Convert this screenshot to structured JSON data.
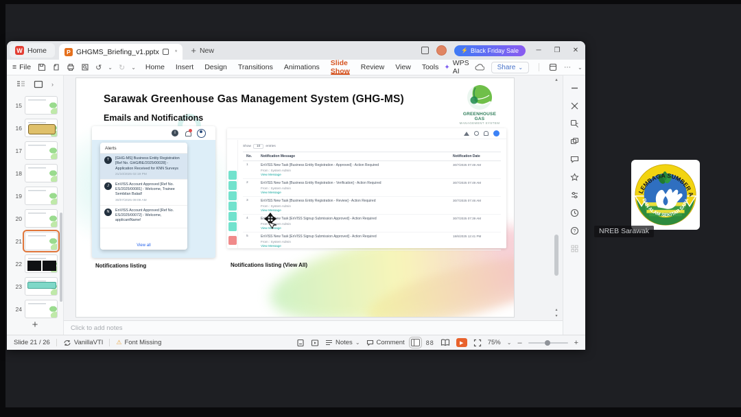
{
  "icons": {
    "hamburger": "≡",
    "caret_down": "⌄",
    "more": "⋯",
    "minimize": "─",
    "restore": "❐",
    "close": "✕",
    "plus": "+",
    "warning": "⚠",
    "unsaved_star": "*",
    "bolt": "⚡",
    "sparkle": "✦",
    "undo": "↺",
    "redo": "↻",
    "scroll_up": "▴",
    "pager": "▴\n▾",
    "info_i": "i",
    "play": "▶",
    "minus": "–",
    "chevron_right": "›",
    "grid88": "88"
  },
  "titlebar": {
    "home_tab": "Home",
    "wps_logo": "W",
    "doc_tab": "GHGMS_Briefing_v1.pptx",
    "ppt_badge": "P",
    "new_label": "New",
    "promo": "Black Friday Sale"
  },
  "menubar": {
    "file": "File",
    "items": [
      {
        "label": "Home"
      },
      {
        "label": "Insert"
      },
      {
        "label": "Design"
      },
      {
        "label": "Transitions"
      },
      {
        "label": "Animations"
      },
      {
        "label": "Slide Show",
        "active": true
      },
      {
        "label": "Review"
      },
      {
        "label": "View"
      },
      {
        "label": "Tools"
      }
    ],
    "wps_ai": "WPS AI",
    "share": "Share"
  },
  "slide_panel": {
    "slides": [
      {
        "n": "15"
      },
      {
        "n": "16",
        "variant": "gold"
      },
      {
        "n": "17"
      },
      {
        "n": "18"
      },
      {
        "n": "19"
      },
      {
        "n": "20"
      },
      {
        "n": "21",
        "selected": true
      },
      {
        "n": "22",
        "variant": "dark"
      },
      {
        "n": "23",
        "variant": "teal"
      },
      {
        "n": "24"
      }
    ]
  },
  "slide": {
    "title": "Sarawak Greenhouse Gas Management System (GHG-MS)",
    "subtitle": "Emails and Notifications",
    "logo_line1": "GREENHOUSE GAS",
    "logo_line2": "MANAGEMENT SYSTEM",
    "caption_left": "Notifications listing",
    "caption_right": "Notifications listing (View All)",
    "alerts_panel": {
      "header": "Alerts",
      "view_all": "View all",
      "items": [
        {
          "avatar": "T",
          "text": "[GHG-MS] Business Entity Registration [Ref No. GHG/BE/2025/00028] - Application Received for KNN Surveys",
          "date": "21/10/2025 02:19 PM",
          "selected": true
        },
        {
          "avatar": "J",
          "text": "EnVISS Account Approved [Ref No. ES/2025/00081] - Welcome, Trainee Sembilan Balad!",
          "date": "30/07/2025 09:09 AM"
        },
        {
          "avatar": "N",
          "text": "EnVISS Account Approved [Ref No. ES/2025/00072] - Welcome, applicantName!",
          "date": ""
        }
      ]
    },
    "table": {
      "show_label": "Show",
      "show_value": "10",
      "entries_label": "entries",
      "col_no": "No.",
      "col_message": "Notification Message",
      "col_date": "Notification Date",
      "from_label": "From : System Admin",
      "view_label": "View Message",
      "rows": [
        {
          "no": "1",
          "message": "EnVISS New Task [Business Entity Registration - Approved] - Action Required",
          "date": "30/7/2025 07:49 AM"
        },
        {
          "no": "2",
          "message": "EnVISS New Task [Business Entity Registration - Verification] - Action Required",
          "date": "30/7/2025 07:49 AM"
        },
        {
          "no": "3",
          "message": "EnVISS New Task [Business Entity Registration - Review] - Action Required",
          "date": "30/7/2025 07:46 AM"
        },
        {
          "no": "4",
          "message": "EnVISS New Task [EnVISS Signup Submission Approved] - Action Required",
          "date": "30/7/2025 07:39 AM"
        },
        {
          "no": "5",
          "message": "EnVISS New Task [EnVISS Signup Submission Approved] - Action Required",
          "date": "18/6/2025 12:41 PM"
        }
      ]
    }
  },
  "notes_placeholder": "Click to add notes",
  "statusbar": {
    "slide_indicator": "Slide 21 / 26",
    "theme": "VanillaVTI",
    "font_missing": "Font Missing",
    "notes_label": "Notes",
    "comment_label": "Comment",
    "zoom": "75%"
  },
  "meeting": {
    "participant_name": "NREB Sarawak",
    "logo_top_text": "LEMBAGA SUMBER ASLI",
    "logo_bottom_text": "DAN ALAM SEKITAR SARAWAK"
  },
  "colors": {
    "accent_orange": "#d6531f",
    "promo_gradient_start": "#3f7bf5",
    "promo_gradient_end": "#8a5bf0",
    "teal_sidebar": "#72e2cd",
    "alert_selected_bg": "#d8e5f1"
  }
}
